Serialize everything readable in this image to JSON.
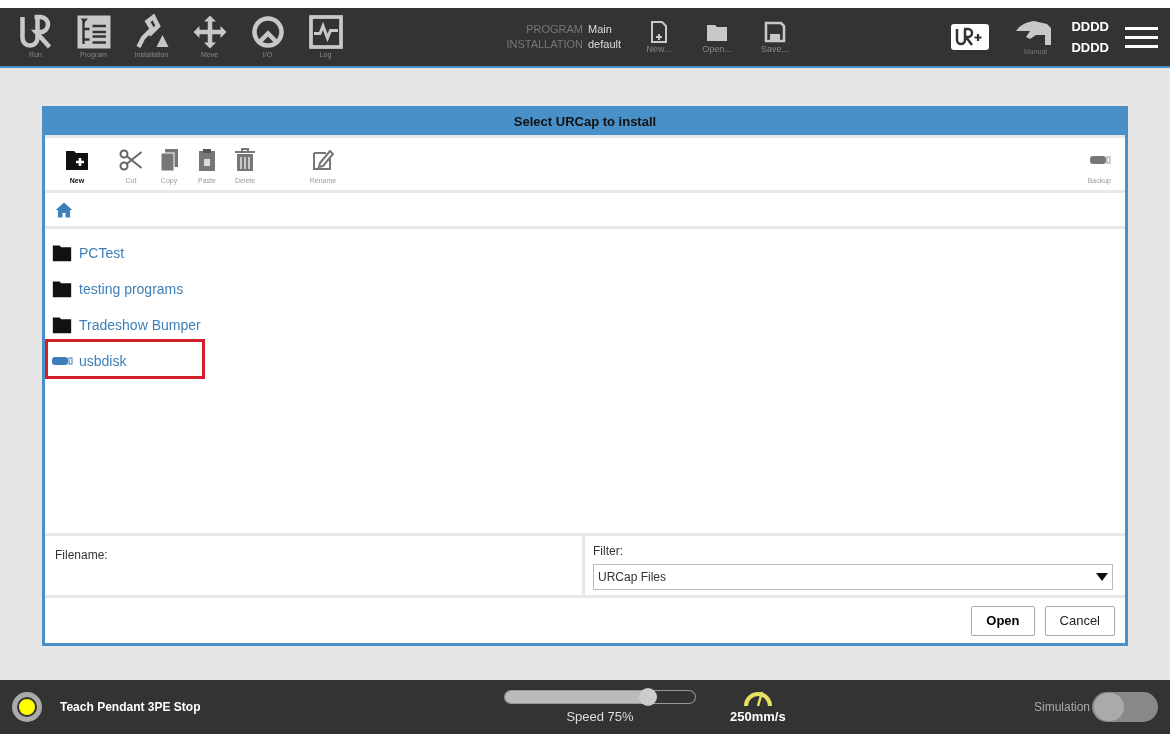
{
  "nav_tabs": [
    {
      "label": "Run"
    },
    {
      "label": "Program"
    },
    {
      "label": "Installation"
    },
    {
      "label": "Move"
    },
    {
      "label": "I/O"
    },
    {
      "label": "Log"
    }
  ],
  "program_info": [
    {
      "key": "PROGRAM",
      "value": "Main"
    },
    {
      "key": "INSTALLATION",
      "value": "default"
    }
  ],
  "file_actions": [
    {
      "label": "New..."
    },
    {
      "label": "Open..."
    },
    {
      "label": "Save..."
    }
  ],
  "mode": {
    "label": "Manual"
  },
  "user": {
    "line1": "DDDD",
    "line2": "DDDD"
  },
  "dialog": {
    "title": "Select URCap to install",
    "toolbar": [
      {
        "label": "New",
        "disabled": false
      },
      {
        "label": "Cut",
        "disabled": true
      },
      {
        "label": "Copy",
        "disabled": true
      },
      {
        "label": "Paste",
        "disabled": true
      },
      {
        "label": "Delete",
        "disabled": true
      },
      {
        "label": "Rename",
        "disabled": true
      }
    ],
    "backup": {
      "label": "Backup"
    },
    "files": [
      {
        "name": "PCTest",
        "kind": "folder",
        "highlighted": false
      },
      {
        "name": "testing programs",
        "kind": "folder",
        "highlighted": false
      },
      {
        "name": "Tradeshow Bumper",
        "kind": "folder",
        "highlighted": false
      },
      {
        "name": "usbdisk",
        "kind": "usb",
        "highlighted": true
      }
    ],
    "filename": {
      "label": "Filename:"
    },
    "filter": {
      "label": "Filter:",
      "value": "URCap Files"
    },
    "buttons": [
      "Open",
      "Cancel"
    ]
  },
  "status": {
    "label": "Teach Pendant 3PE Stop",
    "color": "#ffff00"
  },
  "speed": {
    "level": 0.75,
    "label": "Speed 75%"
  },
  "tcp_speed": "250mm/s",
  "simulation": {
    "label": "Simulation",
    "on": false
  }
}
